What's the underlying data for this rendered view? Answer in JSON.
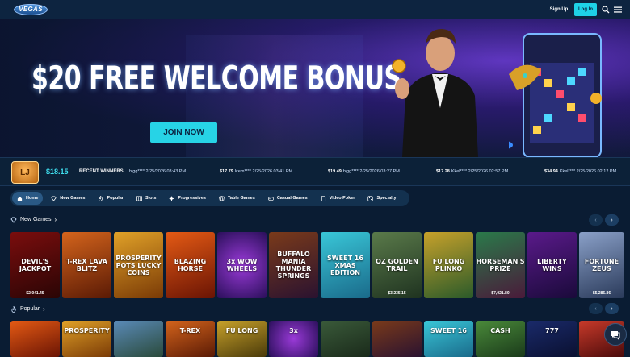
{
  "header": {
    "logo_text": "VEGAS",
    "signup_label": "Sign Up",
    "login_label": "Log In"
  },
  "hero": {
    "title": "$20 FREE WELCOME BONUS",
    "cta_label": "JOIN NOW"
  },
  "ticker": {
    "badge": "LJ",
    "jackpot_amount": "$18.15",
    "recent_winners_label": "RECENT WINNERS",
    "winners": [
      {
        "amount": "",
        "text": "bigg**** 2/25/2026 03:43 PM"
      },
      {
        "amount": "$17.79",
        "text": "lcem**** 2/25/2026 03:41 PM"
      },
      {
        "amount": "$19.49",
        "text": "bigg**** 2/25/2026 03:27 PM"
      },
      {
        "amount": "$17.28",
        "text": "Kkel**** 2/25/2026 02:57 PM"
      },
      {
        "amount": "$34.94",
        "text": "Kkel**** 2/25/2026 02:12 PM"
      }
    ]
  },
  "nav": {
    "categories": [
      "Home",
      "New Games",
      "Popular",
      "Slots",
      "Progressives",
      "Table Games",
      "Casual Games",
      "Video Poker",
      "Specialty"
    ]
  },
  "sections": {
    "new_games": {
      "title": "New Games",
      "tiles": [
        {
          "name": "DEVIL'S JACKPOT",
          "jackpot": "$2,041.45"
        },
        {
          "name": "T-REX LAVA BLITZ",
          "jackpot": ""
        },
        {
          "name": "PROSPERITY POTS LUCKY COINS",
          "jackpot": ""
        },
        {
          "name": "BLAZING HORSE",
          "jackpot": ""
        },
        {
          "name": "3x WOW WHEELS",
          "jackpot": ""
        },
        {
          "name": "BUFFALO MANIA THUNDER SPRINGS",
          "jackpot": ""
        },
        {
          "name": "SWEET 16 XMAS EDITION",
          "jackpot": ""
        },
        {
          "name": "OZ GOLDEN TRAIL",
          "jackpot": "$3,235.15"
        },
        {
          "name": "FU LONG PLINKO",
          "jackpot": ""
        },
        {
          "name": "HORSEMAN'S PRIZE",
          "jackpot": "$7,021.80"
        },
        {
          "name": "LIBERTY WINS",
          "jackpot": ""
        },
        {
          "name": "FORTUNE ZEUS",
          "jackpot": "$5,286.86"
        }
      ]
    },
    "popular": {
      "title": "Popular",
      "tiles": [
        {
          "name": ""
        },
        {
          "name": "PROSPERITY"
        },
        {
          "name": ""
        },
        {
          "name": "T-REX"
        },
        {
          "name": "FU LONG"
        },
        {
          "name": "3x"
        },
        {
          "name": ""
        },
        {
          "name": ""
        },
        {
          "name": "SWEET 16"
        },
        {
          "name": "CASH"
        },
        {
          "name": "777"
        },
        {
          "name": ""
        }
      ]
    }
  },
  "colors": {
    "accent": "#27d3e6",
    "background": "#0a1c33",
    "panel": "#13314f"
  }
}
